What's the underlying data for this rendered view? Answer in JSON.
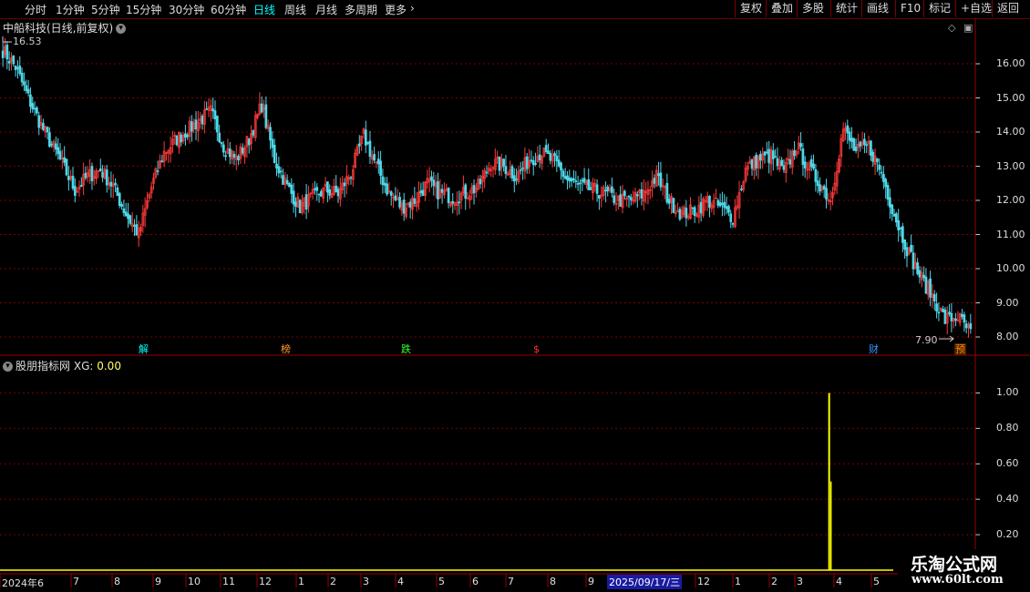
{
  "toolbar": {
    "timeframes": [
      "分时",
      "1分钟",
      "5分钟",
      "15分钟",
      "30分钟",
      "60分钟",
      "日线",
      "周线",
      "月线",
      "多周期",
      "更多"
    ],
    "active_timeframe": "日线",
    "more_arrow": "›",
    "right_buttons": [
      "复权",
      "叠加",
      "多股",
      "统计",
      "画线",
      "F10",
      "标记",
      "+自选",
      "返回"
    ]
  },
  "stock": {
    "title": "中船科技(日线,前复权)",
    "high_label": "16.53",
    "low_label": "7.90"
  },
  "indicator": {
    "name": "股朋指标网",
    "xg_label": "XG:",
    "xg_value": "0.00"
  },
  "price_axis": [
    "16.00",
    "15.00",
    "14.00",
    "13.00",
    "12.00",
    "11.00",
    "10.00",
    "9.00",
    "8.00"
  ],
  "ind_axis": [
    "1.00",
    "0.80",
    "0.60",
    "0.40",
    "0.20"
  ],
  "badges": [
    {
      "text": "解",
      "color": "#00ffff"
    },
    {
      "text": "榜",
      "color": "#ff9933"
    },
    {
      "text": "跌",
      "color": "#33ff33"
    },
    {
      "text": "$",
      "color": "#ff3333"
    },
    {
      "text": "财",
      "color": "#3399ff"
    },
    {
      "text": "预",
      "color": "#ff8800"
    }
  ],
  "date_axis": [
    "2024年6",
    "7",
    "8",
    "9",
    "10",
    "11",
    "12",
    "1",
    "2",
    "3",
    "4",
    "5",
    "6",
    "7",
    "8",
    "9",
    "12",
    "1",
    "2",
    "3",
    "4",
    "5"
  ],
  "selected_date": "2025/09/17/三",
  "colors": {
    "up": "#ff3a3a",
    "down": "#4fd8e8",
    "indicator": "#ffff00",
    "grid": "#7a0000",
    "accent": "#00ffff"
  },
  "logo": {
    "line1": "乐淘公式网",
    "line2": "www.60lt.com"
  },
  "chart_data": {
    "type": "candlestick",
    "price_range": [
      7.6,
      16.8
    ],
    "high_marker": 16.53,
    "low_marker": 7.9,
    "close_waypoints": [
      [
        0,
        16.4
      ],
      [
        6,
        15.9
      ],
      [
        12,
        15.0
      ],
      [
        18,
        14.2
      ],
      [
        26,
        13.3
      ],
      [
        34,
        12.3
      ],
      [
        40,
        12.7
      ],
      [
        46,
        12.9
      ],
      [
        52,
        12.4
      ],
      [
        58,
        11.6
      ],
      [
        64,
        11.0
      ],
      [
        70,
        12.4
      ],
      [
        76,
        13.4
      ],
      [
        82,
        13.8
      ],
      [
        90,
        14.2
      ],
      [
        98,
        14.6
      ],
      [
        104,
        13.6
      ],
      [
        110,
        13.2
      ],
      [
        116,
        13.8
      ],
      [
        122,
        14.8
      ],
      [
        128,
        13.2
      ],
      [
        134,
        12.4
      ],
      [
        140,
        11.8
      ],
      [
        146,
        12.1
      ],
      [
        152,
        12.3
      ],
      [
        158,
        12.2
      ],
      [
        164,
        12.8
      ],
      [
        170,
        13.9
      ],
      [
        176,
        13.0
      ],
      [
        182,
        12.2
      ],
      [
        188,
        11.8
      ],
      [
        194,
        12.0
      ],
      [
        200,
        12.5
      ],
      [
        206,
        12.2
      ],
      [
        212,
        12.1
      ],
      [
        218,
        12.2
      ],
      [
        224,
        12.4
      ],
      [
        230,
        13.1
      ],
      [
        236,
        13.0
      ],
      [
        242,
        12.7
      ],
      [
        248,
        13.2
      ],
      [
        254,
        13.4
      ],
      [
        260,
        13.1
      ],
      [
        266,
        12.6
      ],
      [
        272,
        12.4
      ],
      [
        278,
        12.3
      ],
      [
        284,
        12.2
      ],
      [
        290,
        12.0
      ],
      [
        296,
        12.0
      ],
      [
        302,
        12.2
      ],
      [
        308,
        12.7
      ],
      [
        314,
        12.0
      ],
      [
        320,
        11.6
      ],
      [
        326,
        11.7
      ],
      [
        332,
        12.0
      ],
      [
        338,
        11.8
      ],
      [
        344,
        11.5
      ],
      [
        350,
        12.9
      ],
      [
        356,
        13.2
      ],
      [
        362,
        13.3
      ],
      [
        368,
        12.8
      ],
      [
        374,
        13.6
      ],
      [
        380,
        12.9
      ],
      [
        386,
        12.4
      ],
      [
        390,
        12.0
      ],
      [
        396,
        14.1
      ],
      [
        402,
        13.4
      ],
      [
        408,
        13.6
      ],
      [
        414,
        12.8
      ],
      [
        420,
        11.6
      ],
      [
        426,
        10.6
      ],
      [
        432,
        9.8
      ],
      [
        438,
        9.2
      ],
      [
        444,
        8.5
      ],
      [
        450,
        8.6
      ],
      [
        456,
        8.1
      ]
    ],
    "indicator": {
      "name": "XG",
      "range": [
        0,
        1.1
      ],
      "spike_position": 0.805,
      "spike_value": 1.0
    }
  }
}
